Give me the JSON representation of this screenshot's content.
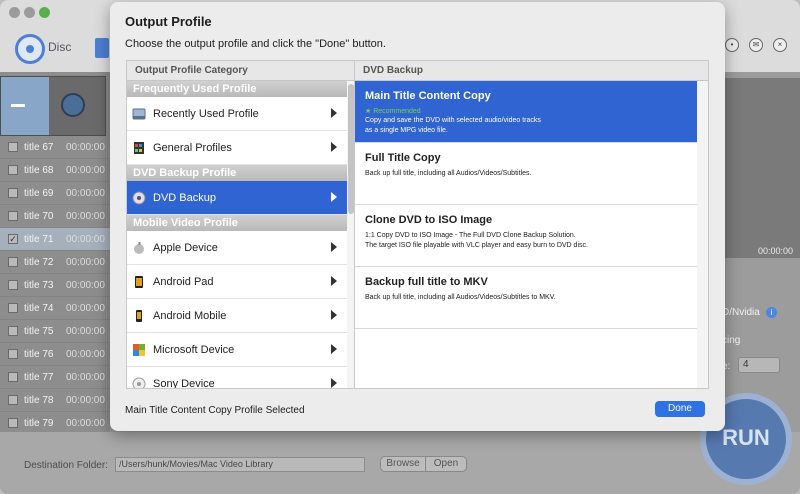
{
  "app": {
    "disc_label": "Disc",
    "titles": [
      {
        "name": "title 67",
        "time": "00:00:00",
        "checked": false
      },
      {
        "name": "title 68",
        "time": "00:00:00",
        "checked": false
      },
      {
        "name": "title 69",
        "time": "00:00:00",
        "checked": false
      },
      {
        "name": "title 70",
        "time": "00:00:00",
        "checked": false
      },
      {
        "name": "title 71",
        "time": "00:00:00",
        "checked": true
      },
      {
        "name": "title 72",
        "time": "00:00:00",
        "checked": false
      },
      {
        "name": "title 73",
        "time": "00:00:00",
        "checked": false
      },
      {
        "name": "title 74",
        "time": "00:00:00",
        "checked": false
      },
      {
        "name": "title 75",
        "time": "00:00:00",
        "checked": false
      },
      {
        "name": "title 76",
        "time": "00:00:00",
        "checked": false
      },
      {
        "name": "title 77",
        "time": "00:00:00",
        "checked": false
      },
      {
        "name": "title 78",
        "time": "00:00:00",
        "checked": false
      },
      {
        "name": "title 79",
        "time": "00:00:00",
        "checked": false
      }
    ],
    "preview_time": "00:00:00",
    "nvidia_text": "D/Nvidia",
    "cing_text": "cing",
    "e_label": "e:",
    "select_value": "4",
    "run_label": "RUN",
    "destination_label": "Destination Folder:",
    "destination_value": "/Users/hunk/Movies/Mac Video Library",
    "browse_label": "Browse",
    "open_label": "Open"
  },
  "dialog": {
    "title": "Output Profile",
    "subtitle": "Choose the output profile and click the \"Done\" button.",
    "category_header": "Output Profile Category",
    "profile_header": "DVD Backup",
    "sections": [
      {
        "label": "Frequently Used Profile",
        "items": [
          {
            "label": "Recently Used Profile",
            "icon": "recent-icon",
            "selected": false
          },
          {
            "label": "General Profiles",
            "icon": "film-icon",
            "selected": false
          }
        ]
      },
      {
        "label": "DVD Backup Profile",
        "items": [
          {
            "label": "DVD Backup",
            "icon": "disc-icon",
            "selected": true
          }
        ]
      },
      {
        "label": "Mobile Video Profile",
        "items": [
          {
            "label": "Apple Device",
            "icon": "apple-icon",
            "selected": false
          },
          {
            "label": "Android Pad",
            "icon": "tablet-icon",
            "selected": false
          },
          {
            "label": "Android Mobile",
            "icon": "phone-icon",
            "selected": false
          },
          {
            "label": "Microsoft Device",
            "icon": "windows-icon",
            "selected": false
          },
          {
            "label": "Sony Device",
            "icon": "sony-icon",
            "selected": false
          }
        ]
      }
    ],
    "profiles": [
      {
        "name": "Main Title Content Copy",
        "badge": "★ Recommended",
        "desc": [
          "Copy and save the DVD with selected audio/video tracks",
          "as a single MPG video file."
        ],
        "selected": true
      },
      {
        "name": "Full Title Copy",
        "badge": "",
        "desc": [
          "Back up full title, including all Audios/Videos/Subtitles."
        ],
        "selected": false
      },
      {
        "name": "Clone DVD to ISO Image",
        "badge": "",
        "desc": [
          "1:1 Copy DVD to ISO Image - The Full DVD Clone Backup Solution.",
          "The target ISO file playable with VLC player and easy burn to DVD disc."
        ],
        "selected": false
      },
      {
        "name": "Backup full title to MKV",
        "badge": "",
        "desc": [
          "Back up full title, including all Audios/Videos/Subtitles to MKV."
        ],
        "selected": false
      }
    ],
    "status": "Main Title Content Copy Profile Selected",
    "done_label": "Done"
  }
}
